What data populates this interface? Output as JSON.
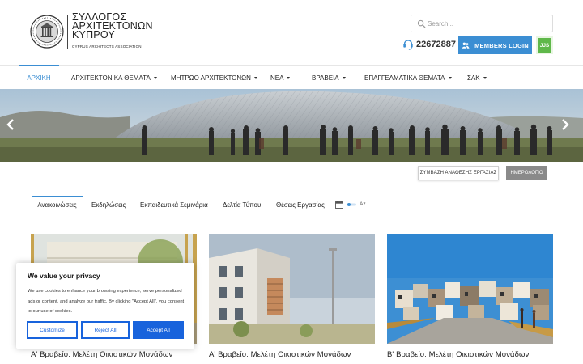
{
  "header": {
    "logo": {
      "line1": "ΣΥΛΛΟΓΟΣ",
      "line2": "ΑΡΧΙΤΕΚΤΟΝΩΝ",
      "line3": "ΚΥΠΡΟΥ",
      "line4": "CYPRUS ARCHITECTS ASSOCIATION",
      "seal_icon": "association-seal-icon"
    },
    "search": {
      "placeholder": "Search...",
      "value": "",
      "icon": "search-icon"
    },
    "phone": {
      "icon": "phone-icon",
      "number": "22672887"
    },
    "members_login": {
      "label": "MEMBERS LOGIN",
      "icon": "users-icon"
    },
    "jjs_badge": {
      "label": "JJS"
    }
  },
  "nav": {
    "items": [
      {
        "label": "ΑΡΧΙΚΗ",
        "active": true,
        "dropdown": false
      },
      {
        "label": "ΑΡΧΙΤΕΚΤΟΝΙΚΑ ΘΕΜΑΤΑ",
        "active": false,
        "dropdown": true
      },
      {
        "label": "ΜΗΤΡΩΟ ΑΡΧΙΤΕΚΤΟΝΩΝ",
        "active": false,
        "dropdown": true
      },
      {
        "label": "ΝΕΑ",
        "active": false,
        "dropdown": true
      },
      {
        "label": "ΒΡΑΒΕΙΑ",
        "active": false,
        "dropdown": true
      },
      {
        "label": "ΕΠΑΓΓΕΛΜΑΤΙΚΑ ΘΕΜΑΤΑ",
        "active": false,
        "dropdown": true
      },
      {
        "label": "ΣΑΚ",
        "active": false,
        "dropdown": true
      }
    ]
  },
  "hero": {
    "prev_icon": "chevron-left-icon",
    "next_icon": "chevron-right-icon"
  },
  "actions": {
    "agreement": "ΣΥΜΒΑΣΗ ΑΝΑΘΕΣΗΣ ΕΡΓΑΣΙΑΣ",
    "calendar": "ΗΜΕΡΟΛΟΓΙΟ"
  },
  "tabs": {
    "items": [
      {
        "label": "Ανακοινώσεις",
        "active": true
      },
      {
        "label": "Εκδηλώσεις",
        "active": false
      },
      {
        "label": "Εκπαιδευτικά Σεμινάρια",
        "active": false
      },
      {
        "label": "Δελτία Τύπου",
        "active": false
      },
      {
        "label": "Θέσεις Εργασίας",
        "active": false
      }
    ],
    "sort_calendar_icon": "calendar-icon",
    "sort_toggle_icon": "toggle-icon",
    "sort_az": "Az"
  },
  "cards": [
    {
      "title": "Α' Βραβείο: Μελέτη Οικιστικών Μονάδων"
    },
    {
      "title": "Α' Βραβείο: Μελέτη Οικιστικών Μονάδων"
    },
    {
      "title": "Β' Βραβείο: Μελέτη Οικιστικών Μονάδων"
    }
  ],
  "cookie": {
    "title": "We value your privacy",
    "text": "We use cookies to enhance your browsing experience, serve personalized ads or content, and analyze our traffic. By clicking \"Accept All\", you consent to our use of cookies.",
    "customize": "Customize",
    "reject": "Reject All",
    "accept": "Accept All"
  },
  "colors": {
    "accent": "#3b8ed3",
    "jjs_green": "#5fb84a",
    "cookie_blue": "#1863dc",
    "calendar_gray": "#8a8a8a"
  }
}
